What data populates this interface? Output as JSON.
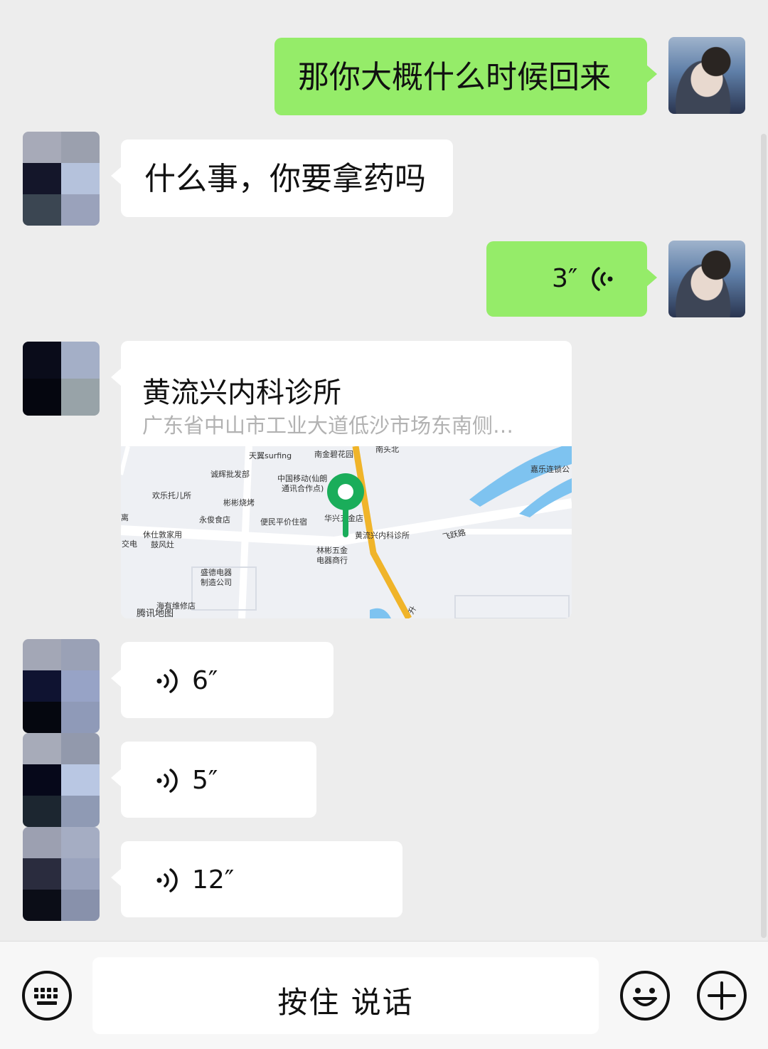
{
  "messages": {
    "m1_text": "那你大概什么时候回来",
    "m2_text": "什么事，你要拿药吗",
    "m3_voice": "3″",
    "location": {
      "title": "黄流兴内科诊所",
      "address": "广东省中山市工业大道低沙市场东南侧…",
      "map_labels": {
        "nanjin": "南金碧花园",
        "tianyi": "天翼surfing",
        "nantou": "南头北",
        "chenghui": "诚辉批发部",
        "cmcc": "中国移动(仙朗",
        "cmcc2": "通讯合作点)",
        "jiale": "嘉乐连锁公",
        "huanle": "欢乐托儿所",
        "binbin": "彬彬烧烤",
        "yongjun": "永俊食店",
        "bianmin": "便民平价住宿",
        "huaxing": "华兴五金店",
        "clinic": "黄流兴内科诊所",
        "feiyue": "飞跃路",
        "xiushi": "休仕敦家用",
        "guzao": "鼓风灶",
        "jiao": "交电",
        "linbin": "林彬五金",
        "dianqi": "电器商行",
        "shengde": "盛德电器",
        "zhizao": "制造公司",
        "haiyou": "海有维修店",
        "tencent": "腾讯地图",
        "li": "离",
        "sheng": "升"
      }
    },
    "v1": "6″",
    "v2": "5″",
    "v3": "12″"
  },
  "bottom": {
    "talk_label": "按住 说话"
  },
  "icons": {
    "keyboard": "keyboard-icon",
    "emoji": "emoji-icon",
    "plus": "plus-icon",
    "voice": "voice-icon",
    "pin": "map-pin-icon"
  },
  "colors": {
    "my_bubble": "#95ec69",
    "their_bubble": "#ffffff",
    "background": "#ededed",
    "pin": "#1aad5a",
    "road": "#f0b429"
  }
}
